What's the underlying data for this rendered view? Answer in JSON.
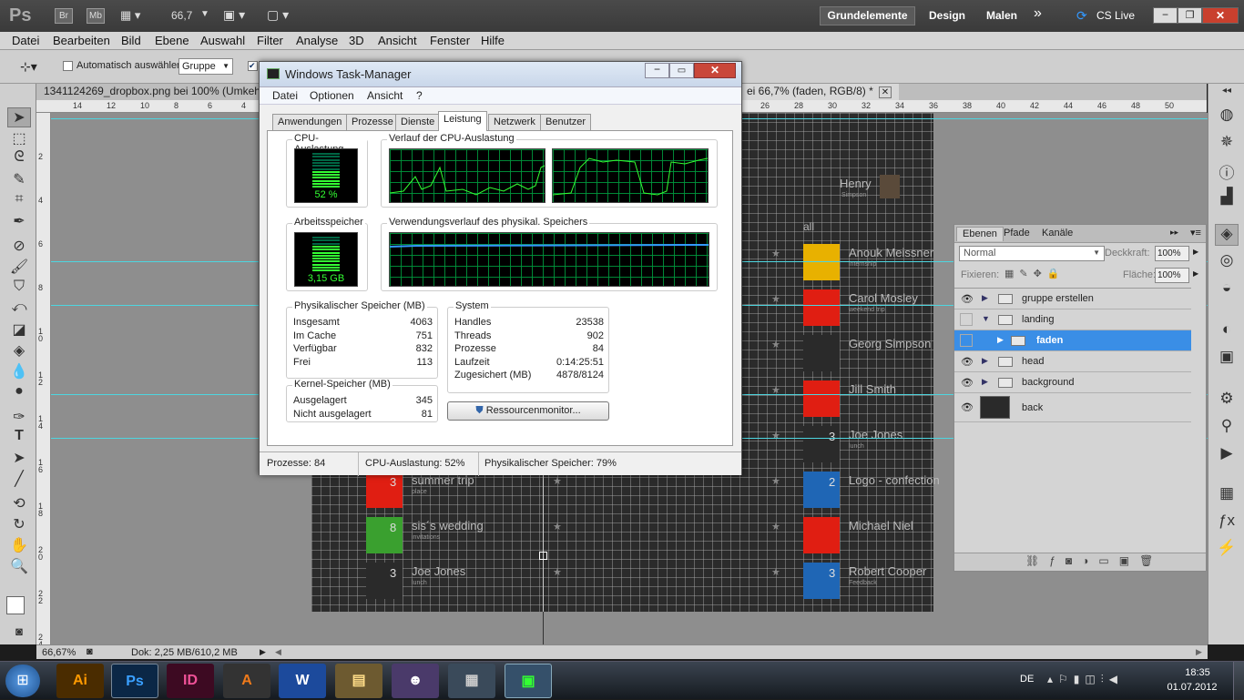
{
  "ps": {
    "logo": "Ps",
    "appbar_buttons": [
      "Br",
      "Mb"
    ],
    "zoom_display": "66,7",
    "workspaces": [
      "Grundelemente",
      "Design",
      "Malen"
    ],
    "more": "»",
    "cslive": "CS Live",
    "menu": [
      "Datei",
      "Bearbeiten",
      "Bild",
      "Ebene",
      "Auswahl",
      "Filter",
      "Analyse",
      "3D",
      "Ansicht",
      "Fenster",
      "Hilfe"
    ],
    "options": {
      "auto_select_label": "Automatisch auswählen:",
      "auto_select_value": "Gruppe"
    },
    "doc_tabs": [
      {
        "title": "1341124269_dropbox.png bei 100% (Umkehr"
      },
      {
        "title": "ei 66,7% (faden, RGB/8) *"
      }
    ],
    "ruler_h": [
      "14",
      "12",
      "10",
      "8",
      "6",
      "4",
      "26",
      "28",
      "30",
      "32",
      "34",
      "36",
      "38",
      "40",
      "42",
      "44",
      "46",
      "48",
      "50"
    ],
    "ruler_v": [
      "2",
      "4",
      "6",
      "8",
      "1 0",
      "1 2",
      "1 4",
      "1 6",
      "1 8",
      "2 0",
      "2 2",
      "2 4"
    ],
    "statusbar": {
      "zoom": "66,67%",
      "doc": "Dok: 2,25 MB/610,2 MB"
    }
  },
  "canvas": {
    "left_items": [
      {
        "label": "summer trip",
        "sub": "place",
        "num": "3"
      },
      {
        "label": "sis´s wedding",
        "sub": "invitations",
        "num": "8"
      },
      {
        "label": "Joe Jones",
        "sub": "lunch",
        "num": "3"
      }
    ],
    "right_items": [
      {
        "label": "Henry",
        "sub": "Simpson"
      },
      {
        "label": "Anouk Meissner",
        "sub": "internship"
      },
      {
        "label": "Carol Mosley",
        "sub": "weekend trip"
      },
      {
        "label": "Georg Simpson",
        "sub": ""
      },
      {
        "label": "Jill Smith",
        "sub": ""
      },
      {
        "label": "Joe Jones",
        "sub": "lunch",
        "num": "3"
      },
      {
        "label": "Logo - confection",
        "sub": "",
        "num": "2"
      },
      {
        "label": "Michael Niel",
        "sub": ""
      },
      {
        "label": "Robert Cooper",
        "sub": "Feedback",
        "num": "3"
      }
    ],
    "all_label": "all"
  },
  "layers": {
    "tabs": [
      "Ebenen",
      "Pfade",
      "Kanäle"
    ],
    "blend": "Normal",
    "opacity_label": "Deckkraft:",
    "opacity": "100%",
    "lock_label": "Fixieren:",
    "fill_label": "Fläche:",
    "fill": "100%",
    "items": [
      {
        "name": "gruppe erstellen"
      },
      {
        "name": "landing"
      },
      {
        "name": "faden"
      },
      {
        "name": "head"
      },
      {
        "name": "background"
      },
      {
        "name": "back"
      }
    ]
  },
  "tm": {
    "title": "Windows Task-Manager",
    "menu": [
      "Datei",
      "Optionen",
      "Ansicht",
      "?"
    ],
    "tabs": [
      "Anwendungen",
      "Prozesse",
      "Dienste",
      "Leistung",
      "Netzwerk",
      "Benutzer"
    ],
    "cpu_label": "CPU-Auslastung",
    "cpu_value": "52 %",
    "cpu_hist_label": "Verlauf der CPU-Auslastung",
    "mem_label": "Arbeitsspeicher",
    "mem_value": "3,15 GB",
    "mem_hist_label": "Verwendungsverlauf des physikal. Speichers",
    "phys": {
      "title": "Physikalischer Speicher (MB)",
      "rows": [
        {
          "k": "Insgesamt",
          "v": "4063"
        },
        {
          "k": "Im Cache",
          "v": "751"
        },
        {
          "k": "Verfügbar",
          "v": "832"
        },
        {
          "k": "Frei",
          "v": "113"
        }
      ]
    },
    "kernel": {
      "title": "Kernel-Speicher (MB)",
      "rows": [
        {
          "k": "Ausgelagert",
          "v": "345"
        },
        {
          "k": "Nicht ausgelagert",
          "v": "81"
        }
      ]
    },
    "system": {
      "title": "System",
      "rows": [
        {
          "k": "Handles",
          "v": "23538"
        },
        {
          "k": "Threads",
          "v": "902"
        },
        {
          "k": "Prozesse",
          "v": "84"
        },
        {
          "k": "Laufzeit",
          "v": "0:14:25:51"
        },
        {
          "k": "Zugesichert (MB)",
          "v": "4878/8124"
        }
      ]
    },
    "resmon": "Ressourcenmonitor...",
    "status": {
      "proc": "Prozesse: 84",
      "cpu": "CPU-Auslastung: 52%",
      "mem": "Physikalischer Speicher: 79%"
    },
    "cpu_usage": 0.52,
    "mem_usage": 0.79
  },
  "taskbar": {
    "apps": [
      "Ai",
      "Ps",
      "ID",
      "A",
      "W",
      "",
      "",
      "",
      ""
    ],
    "lang": "DE",
    "time": "18:35",
    "date": "01.07.2012"
  }
}
